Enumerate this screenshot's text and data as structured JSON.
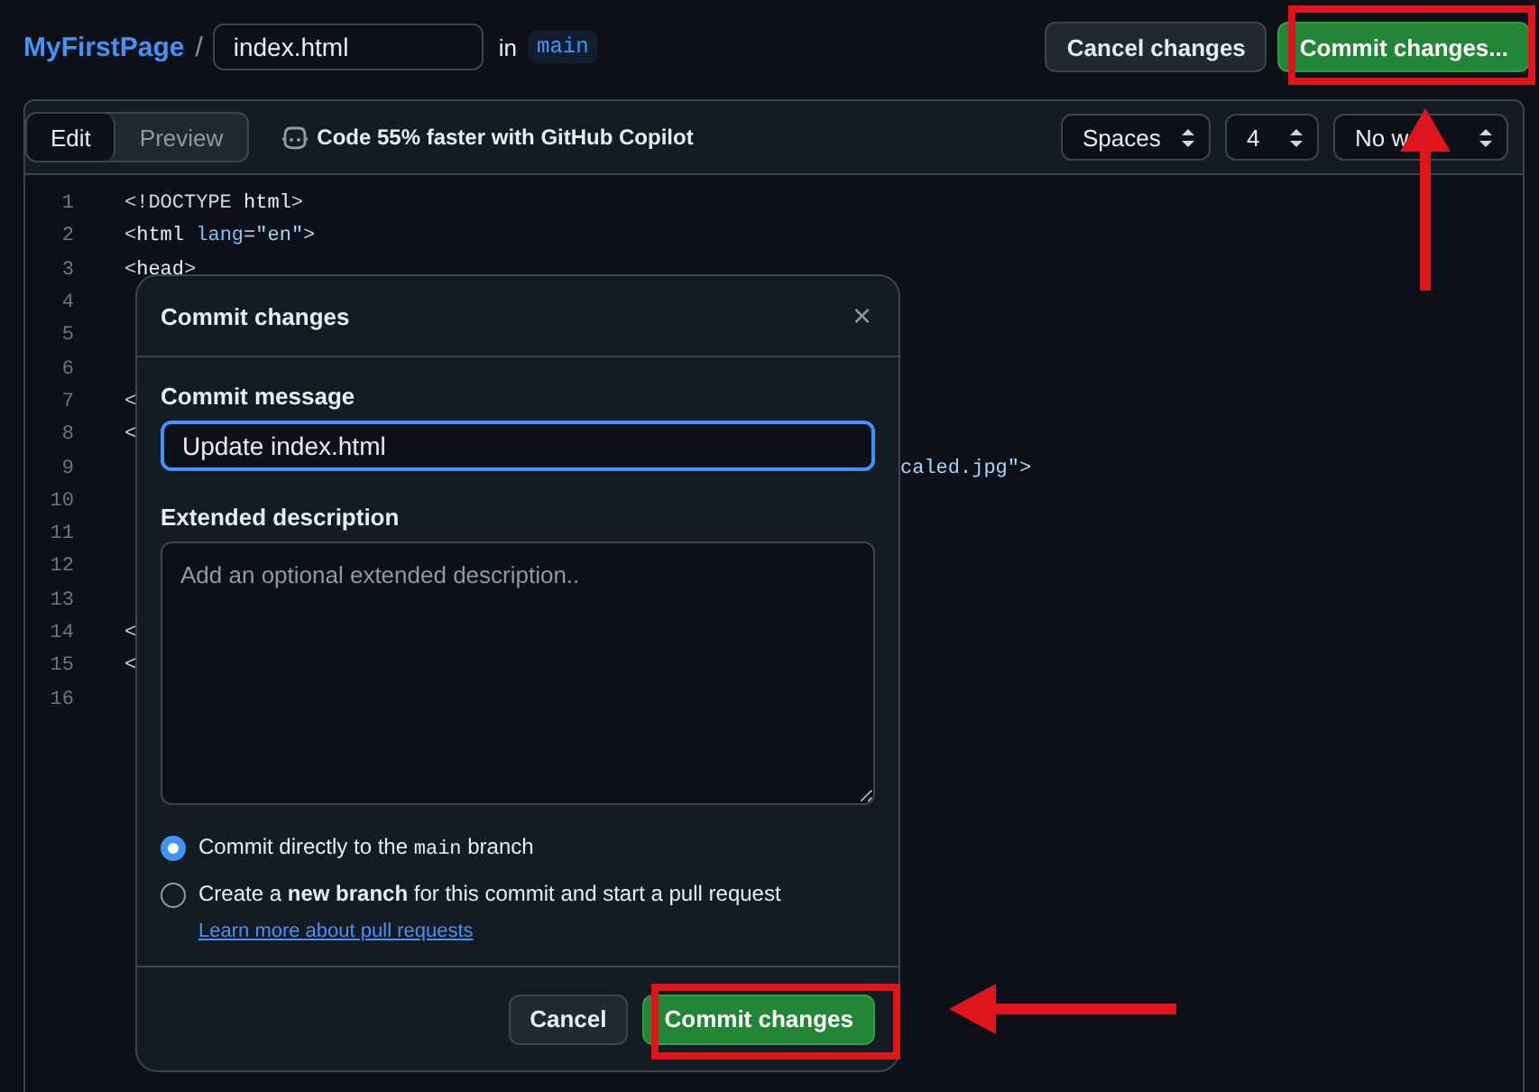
{
  "breadcrumb": {
    "repo": "MyFirstPage",
    "separator": "/",
    "filename": "index.html",
    "in_label": "in",
    "branch": "main"
  },
  "header_buttons": [
    {
      "label": "Cancel changes",
      "kind": "secondary"
    },
    {
      "label": "Commit changes...",
      "kind": "primary"
    }
  ],
  "editor": {
    "tabs": [
      {
        "label": "Edit",
        "selected": true
      },
      {
        "label": "Preview",
        "selected": false
      }
    ],
    "copilot_hint": "Code 55% faster with GitHub Copilot",
    "selects": [
      "Spaces",
      "4",
      "No w"
    ],
    "lines": [
      {
        "number": "1",
        "tokens": [
          {
            "kind": "punct",
            "text": "<!DOCTYPE "
          },
          {
            "kind": "tag",
            "text": "html"
          },
          {
            "kind": "punct",
            "text": ">"
          }
        ]
      },
      {
        "number": "2",
        "tokens": [
          {
            "kind": "punct",
            "text": "<"
          },
          {
            "kind": "tag",
            "text": "html"
          },
          {
            "kind": "attr",
            "text": " lang"
          },
          {
            "kind": "punct",
            "text": "="
          },
          {
            "kind": "string",
            "text": "\"en\""
          },
          {
            "kind": "punct",
            "text": ">"
          }
        ]
      },
      {
        "number": "3",
        "tokens": [
          {
            "kind": "punct",
            "text": "<"
          },
          {
            "kind": "tag",
            "text": "head"
          },
          {
            "kind": "punct",
            "text": ">"
          }
        ]
      },
      {
        "number": "4"
      },
      {
        "number": "5"
      },
      {
        "number": "6"
      },
      {
        "number": "7",
        "tokens": [
          {
            "kind": "punct",
            "text": "<"
          }
        ]
      },
      {
        "number": "8",
        "tokens": [
          {
            "kind": "punct",
            "text": "<"
          }
        ]
      },
      {
        "number": "9",
        "tail": [
          {
            "kind": "string",
            "text": "caled.jpg\""
          },
          {
            "kind": "punct",
            "text": ">"
          }
        ]
      },
      {
        "number": "10"
      },
      {
        "number": "11"
      },
      {
        "number": "12"
      },
      {
        "number": "13"
      },
      {
        "number": "14",
        "tokens": [
          {
            "kind": "punct",
            "text": "<"
          }
        ]
      },
      {
        "number": "15",
        "tokens": [
          {
            "kind": "punct",
            "text": "<"
          }
        ]
      },
      {
        "number": "16"
      }
    ]
  },
  "dialog": {
    "title": "Commit changes",
    "close": "×",
    "message_label": "Commit message",
    "message_value": "Update index.html",
    "description_label": "Extended description",
    "description_placeholder": "Add an optional extended description..",
    "options": [
      {
        "parts": [
          {
            "kind": "text",
            "text": "Commit directly to the "
          },
          {
            "kind": "code",
            "text": "main"
          },
          {
            "kind": "text",
            "text": " branch"
          }
        ],
        "selected": true
      },
      {
        "parts": [
          {
            "kind": "text",
            "text": "Create a **new branch** for this commit and start a pull request"
          }
        ],
        "link": "Learn more about pull requests",
        "selected": false
      }
    ],
    "buttons": [
      {
        "label": "Cancel",
        "kind": "secondary"
      },
      {
        "label": "Commit changes",
        "kind": "primary"
      }
    ]
  }
}
